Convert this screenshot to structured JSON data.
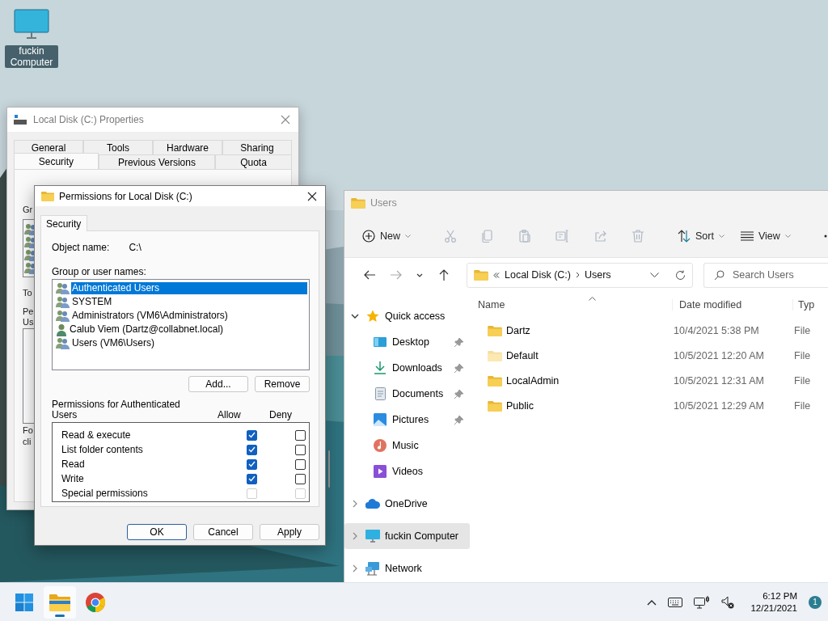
{
  "desktop_icons": [
    {
      "label": "fuckin Computer"
    }
  ],
  "properties_dialog": {
    "title": "Local Disk (C:) Properties",
    "active": false,
    "tab_rows": [
      [
        {
          "label": "General",
          "selected": false
        },
        {
          "label": "Tools",
          "selected": false
        },
        {
          "label": "Hardware",
          "selected": false
        },
        {
          "label": "Sharing",
          "selected": false
        }
      ],
      [
        {
          "label": "Security",
          "selected": true
        },
        {
          "label": "Previous Versions",
          "selected": false
        },
        {
          "label": "Quota",
          "selected": false
        }
      ]
    ],
    "fragments": [
      "Gr",
      "To",
      "Pe",
      "Us",
      "Fo",
      "cli"
    ]
  },
  "permissions_dialog": {
    "title": "Permissions for Local Disk (C:)",
    "tab": "Security",
    "object_label": "Object name:",
    "object_value": "C:\\",
    "groups_label": "Group or user names:",
    "groups": [
      {
        "name": "Authenticated Users",
        "kind": "group",
        "selected": true
      },
      {
        "name": "SYSTEM",
        "kind": "group",
        "selected": false
      },
      {
        "name": "Administrators (VM6\\Administrators)",
        "kind": "group",
        "selected": false
      },
      {
        "name": "Calub Viem (Dartz@collabnet.local)",
        "kind": "user",
        "selected": false
      },
      {
        "name": "Users (VM6\\Users)",
        "kind": "group",
        "selected": false
      }
    ],
    "list_buttons": [
      "Add...",
      "Remove"
    ],
    "permissions_label": "Permissions for Authenticated Users",
    "allow_header": "Allow",
    "deny_header": "Deny",
    "permissions": [
      {
        "label": "Read & execute",
        "allow": {
          "checked": true,
          "disabled": false
        },
        "deny": {
          "checked": false,
          "disabled": false
        }
      },
      {
        "label": "List folder contents",
        "allow": {
          "checked": true,
          "disabled": false
        },
        "deny": {
          "checked": false,
          "disabled": false
        }
      },
      {
        "label": "Read",
        "allow": {
          "checked": true,
          "disabled": false
        },
        "deny": {
          "checked": false,
          "disabled": false
        }
      },
      {
        "label": "Write",
        "allow": {
          "checked": true,
          "disabled": false
        },
        "deny": {
          "checked": false,
          "disabled": false
        }
      },
      {
        "label": "Special permissions",
        "allow": {
          "checked": false,
          "disabled": true
        },
        "deny": {
          "checked": false,
          "disabled": true
        }
      }
    ],
    "buttons": [
      {
        "label": "OK",
        "default": true
      },
      {
        "label": "Cancel",
        "default": false
      },
      {
        "label": "Apply",
        "default": false
      }
    ]
  },
  "explorer": {
    "title": "Users",
    "toolbar_groups": [
      {
        "items": [
          {
            "kind": "new",
            "label": "New",
            "disabled": false
          }
        ]
      },
      {
        "items": [
          {
            "kind": "cut",
            "disabled": true
          },
          {
            "kind": "copy",
            "disabled": true
          },
          {
            "kind": "paste",
            "disabled": true
          },
          {
            "kind": "rename",
            "disabled": true
          },
          {
            "kind": "share",
            "disabled": true
          },
          {
            "kind": "delete",
            "disabled": true
          }
        ]
      },
      {
        "items": [
          {
            "kind": "sort",
            "label": "Sort",
            "disabled": false
          },
          {
            "kind": "view",
            "label": "View",
            "disabled": false
          }
        ]
      },
      {
        "items": [
          {
            "kind": "more",
            "disabled": false
          }
        ]
      }
    ],
    "nav": [
      {
        "kind": "back",
        "disabled": false
      },
      {
        "kind": "forward",
        "disabled": true
      },
      {
        "kind": "recent",
        "disabled": false
      },
      {
        "kind": "up",
        "disabled": false
      }
    ],
    "breadcrumbs": [
      "Local Disk (C:)",
      "Users"
    ],
    "search_placeholder": "Search Users",
    "sidebar": [
      {
        "label": "Quick access",
        "kind": "star",
        "expanded": true,
        "selected": false,
        "children": [
          {
            "label": "Desktop",
            "kind": "desktop",
            "pinned": true,
            "selected": false
          },
          {
            "label": "Downloads",
            "kind": "downloads",
            "pinned": true,
            "selected": false
          },
          {
            "label": "Documents",
            "kind": "documents",
            "pinned": true,
            "selected": false
          },
          {
            "label": "Pictures",
            "kind": "pictures",
            "pinned": true,
            "selected": false
          },
          {
            "label": "Music",
            "kind": "music",
            "pinned": false,
            "selected": false
          },
          {
            "label": "Videos",
            "kind": "videos",
            "pinned": false,
            "selected": false
          }
        ]
      },
      {
        "label": "OneDrive",
        "kind": "cloud",
        "expanded": false,
        "selected": false
      },
      {
        "label": "fuckin Computer",
        "kind": "computer",
        "expanded": false,
        "selected": true
      },
      {
        "label": "Network",
        "kind": "network",
        "expanded": false,
        "selected": false
      }
    ],
    "columns": [
      "Name",
      "Date modified",
      "Typ"
    ],
    "files": [
      {
        "name": "Dartz",
        "date": "10/4/2021 5:38 PM",
        "type": "File",
        "hidden": false
      },
      {
        "name": "Default",
        "date": "10/5/2021 12:20 AM",
        "type": "File",
        "hidden": true
      },
      {
        "name": "LocalAdmin",
        "date": "10/5/2021 12:31 AM",
        "type": "File",
        "hidden": false
      },
      {
        "name": "Public",
        "date": "10/5/2021 12:29 AM",
        "type": "File",
        "hidden": false
      }
    ]
  },
  "taskbar": {
    "apps": [
      {
        "kind": "start",
        "active": false
      },
      {
        "kind": "explorer",
        "active": true
      },
      {
        "kind": "browser",
        "active": false
      }
    ],
    "tray": [
      {
        "kind": "chevron"
      },
      {
        "kind": "keyboard"
      },
      {
        "kind": "network"
      },
      {
        "kind": "volume-muted"
      }
    ],
    "time": "6:12 PM",
    "date": "12/21/2021",
    "notifications": "1"
  }
}
